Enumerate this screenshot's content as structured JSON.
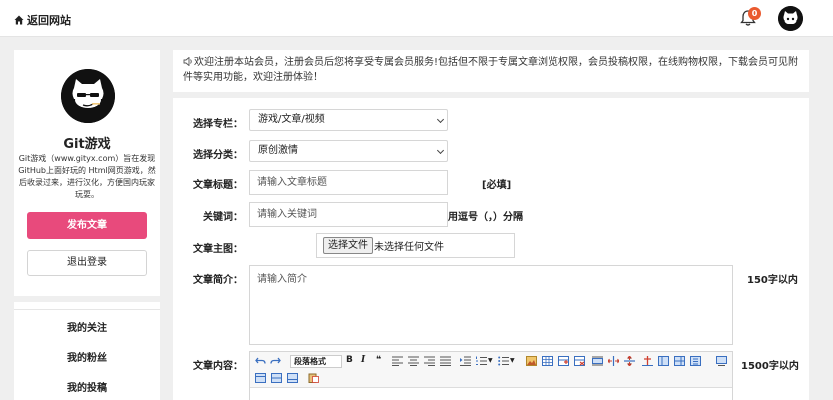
{
  "topbar": {
    "home_label": "返回网站",
    "notification_count": "0"
  },
  "profile": {
    "name": "Git游戏",
    "description": "Git游戏（www.gityx.com）旨在发现GitHub上面好玩的 Html网页游戏，然后收录过来，进行汉化，方便国内玩家玩耍。",
    "publish_label": "发布文章",
    "logout_label": "退出登录"
  },
  "menu": {
    "items": [
      {
        "label": "我的关注"
      },
      {
        "label": "我的粉丝"
      },
      {
        "label": "我的投稿"
      }
    ]
  },
  "notice": "欢迎注册本站会员，注册会员后您将享受专属会员服务!包括但不限于专属文章浏览权限，会员投稿权限，在线购物权限，下载会员可见附件等实用功能，欢迎注册体验！",
  "form": {
    "column_label": "选择专栏：",
    "column_value": "游戏/文章/视频",
    "category_label": "选择分类：",
    "category_value": "原创激情",
    "title_label": "文章标题：",
    "title_placeholder": "请输入文章标题",
    "title_note": "[必填]",
    "keywords_label": "关键词：",
    "keywords_placeholder": "请输入关键词",
    "keywords_note": "用逗号（，）分隔",
    "image_label": "文章主图：",
    "file_button": "选择文件",
    "file_status": "未选择任何文件",
    "summary_label": "文章简介：",
    "summary_placeholder": "请输入简介",
    "summary_note": "150字以内",
    "content_label": "文章内容：",
    "content_note": "1500字以内",
    "editor_format": "段落格式"
  },
  "colors": {
    "accent": "#e84a7c",
    "badge": "#ea5a2f"
  }
}
